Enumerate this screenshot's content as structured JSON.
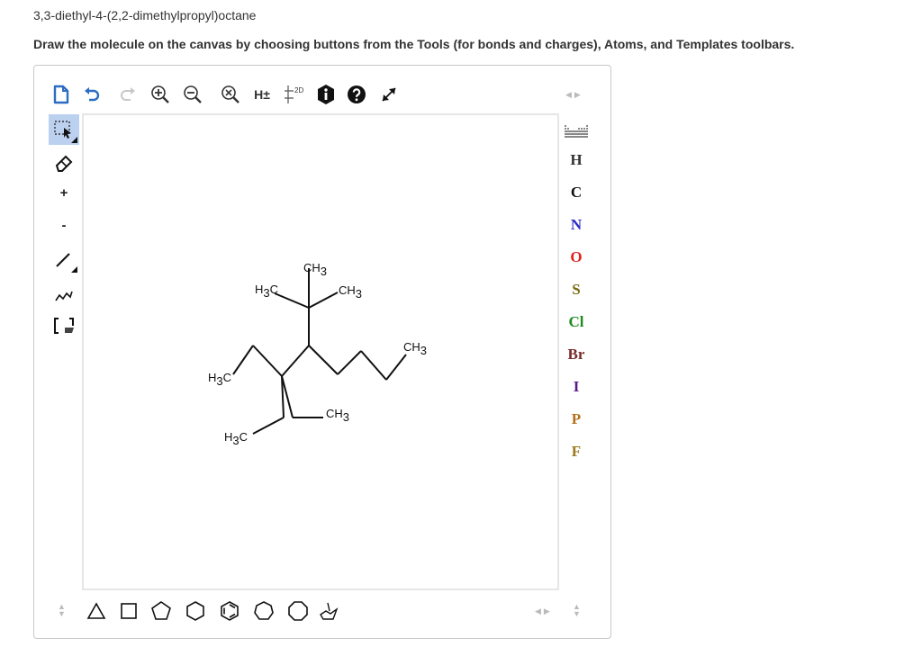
{
  "question": {
    "title": "3,3-diethyl-4-(2,2-dimethylpropyl)octane",
    "instruction": "Draw the molecule on the canvas by choosing buttons from the Tools (for bonds and charges), Atoms, and Templates toolbars."
  },
  "top_toolbar": {
    "hydrogen_toggle": "H±",
    "layout_label": "2D",
    "icons": [
      "new-document-icon",
      "undo-icon",
      "redo-icon",
      "zoom-in-icon",
      "zoom-out-icon",
      "zoom-reset-icon",
      "hydrogen-toggle",
      "clean-2d-icon",
      "info-icon",
      "help-icon",
      "fullscreen-icon"
    ]
  },
  "left_toolbar": {
    "plus_label": "+",
    "minus_label": "-",
    "tools": [
      "selection-tool",
      "eraser-tool",
      "charge-plus-tool",
      "charge-minus-tool",
      "single-bond-tool",
      "chain-tool",
      "bracket-tool"
    ]
  },
  "atoms": {
    "H": {
      "label": "H",
      "color": "#333333"
    },
    "C": {
      "label": "C",
      "color": "#111111"
    },
    "N": {
      "label": "N",
      "color": "#2c2cc8"
    },
    "O": {
      "label": "O",
      "color": "#e0231c"
    },
    "S": {
      "label": "S",
      "color": "#7a6a12"
    },
    "Cl": {
      "label": "Cl",
      "color": "#1f8a1f"
    },
    "Br": {
      "label": "Br",
      "color": "#7a2a2a"
    },
    "I": {
      "label": "I",
      "color": "#5a1a8a"
    },
    "P": {
      "label": "P",
      "color": "#b5701a"
    },
    "F": {
      "label": "F",
      "color": "#9a7a1a"
    }
  },
  "molecule": {
    "groups": {
      "ch3_top": {
        "main": "CH",
        "sub": "3"
      },
      "h3c_left": {
        "pre": "H",
        "sub": "3",
        "post": "C"
      },
      "ch3_right": {
        "main": "CH",
        "sub": "3"
      },
      "ch3_chain": {
        "main": "CH",
        "sub": "3"
      },
      "h3c_mid": {
        "pre": "H",
        "sub": "3",
        "post": "C"
      },
      "ch3_lower": {
        "main": "CH",
        "sub": "3"
      },
      "h3c_lower": {
        "pre": "H",
        "sub": "3",
        "post": "C"
      }
    }
  },
  "bottom_toolbar": {
    "templates": [
      "triangle-template",
      "square-template",
      "pentagon-template",
      "hexagon-template",
      "benzene-template",
      "heptagon-template",
      "octagon-template",
      "chair-template"
    ]
  }
}
